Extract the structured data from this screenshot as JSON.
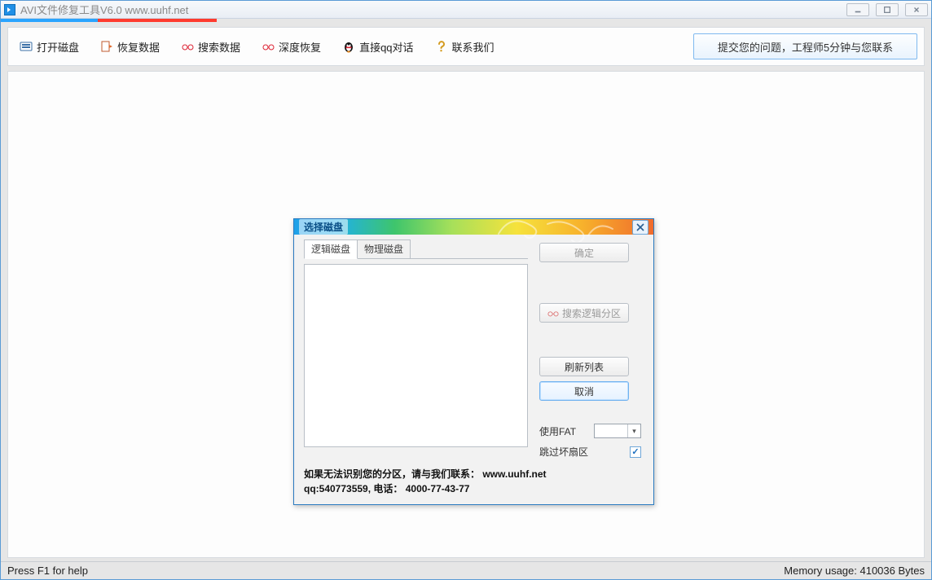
{
  "window": {
    "title": "AVI文件修复工具V6.0 www.uuhf.net"
  },
  "toolbar": {
    "open_disk": "打开磁盘",
    "recover_data": "恢复数据",
    "search_data": "搜索数据",
    "deep_recover": "深度恢复",
    "qq_chat": "直接qq对话",
    "contact_us": "联系我们",
    "submit_question": "提交您的问题，工程师5分钟与您联系"
  },
  "dialog": {
    "title": "选择磁盘",
    "tabs": {
      "logical": "逻辑磁盘",
      "physical": "物理磁盘"
    },
    "buttons": {
      "ok": "确定",
      "search_partition": "搜索逻辑分区",
      "refresh": "刷新列表",
      "cancel": "取消"
    },
    "use_fat_label": "使用FAT",
    "skip_bad_label": "跳过坏扇区",
    "skip_bad_checked": true,
    "footer_line1": "如果无法识别您的分区，请与我们联系： www.uuhf.net",
    "footer_line2": "qq:540773559, 电话： 4000-77-43-77"
  },
  "status": {
    "help": "Press F1 for help",
    "memory": "Memory usage: 410036 Bytes"
  }
}
